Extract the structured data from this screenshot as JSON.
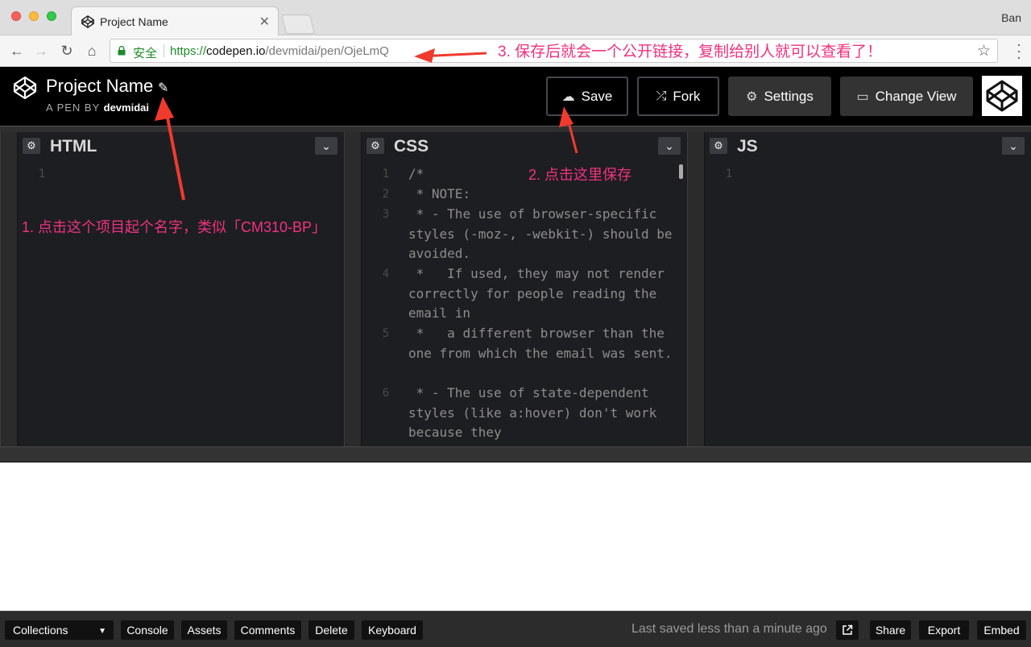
{
  "browser": {
    "tab_title": "Project Name",
    "user_name": "Ban",
    "secure_label": "安全",
    "url_proto": "https://",
    "url_host": "codepen.io",
    "url_path": "/devmidai/pen/OjeLmQ"
  },
  "header": {
    "project_title": "Project Name",
    "byline_prefix": "A PEN BY ",
    "author": "devmidai",
    "buttons": {
      "save": "Save",
      "fork": "Fork",
      "settings": "Settings",
      "change_view": "Change View"
    }
  },
  "panes": [
    {
      "name": "HTML",
      "lines": [
        {
          "num": "1",
          "text": ""
        }
      ]
    },
    {
      "name": "CSS",
      "lines": [
        {
          "num": "1",
          "text": "/*"
        },
        {
          "num": "2",
          "text": " * NOTE:"
        },
        {
          "num": "3",
          "text": " * - The use of browser-specific styles (-moz-, -webkit-) should be avoided."
        },
        {
          "num": "4",
          "text": " *   If used, they may not render correctly for people reading the email in"
        },
        {
          "num": "5",
          "text": " *   a different browser than the one from which the email was sent."
        },
        {
          "num": "6",
          "text": " * - The use of state-dependent styles (like a:hover) don't work because they"
        }
      ]
    },
    {
      "name": "JS",
      "lines": [
        {
          "num": "1",
          "text": ""
        }
      ]
    }
  ],
  "footer": {
    "collections": "Collections",
    "console": "Console",
    "assets": "Assets",
    "comments": "Comments",
    "delete": "Delete",
    "keyboard": "Keyboard",
    "last_saved": "Last saved less than a minute ago",
    "share": "Share",
    "export": "Export",
    "embed": "Embed"
  },
  "annotations": {
    "step1": "1. 点击这个项目起个名字，类似「CM310-BP」",
    "step2": "2. 点击这里保存",
    "step3": "3. 保存后就会一个公开链接，复制给别人就可以查看了！"
  },
  "colors": {
    "annotation": "#f0327e",
    "header_bg": "#000000",
    "pane_bg": "#1d1e22",
    "secure_green": "#1c8a28"
  }
}
